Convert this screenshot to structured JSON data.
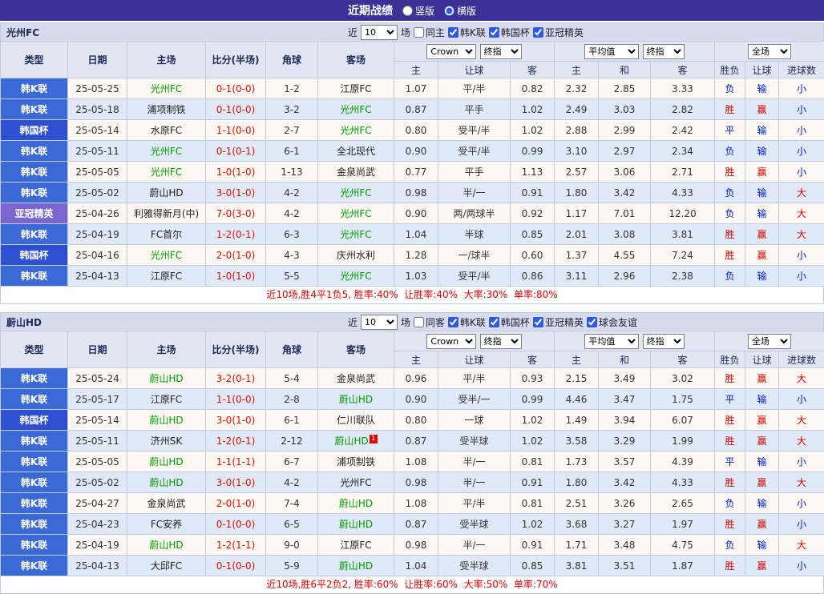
{
  "topbar": {
    "title": "近期战绩",
    "vertical_label": "竖版",
    "horizontal_label": "横版",
    "selected_layout": "横版"
  },
  "colors": {
    "topbar_bg": "#3d3195",
    "badge_k_league": "#3b69d5",
    "badge_korea_cup": "#2d4fd0",
    "badge_acl": "#7a66cf",
    "focus_team": "#009900",
    "score": "#e01000",
    "win": "#d40000",
    "lose": "#0020cc",
    "summary": "#e60000"
  },
  "sections": [
    {
      "team": "光州FC",
      "filter": {
        "near_label": "近",
        "count": "10",
        "games_label": "场",
        "same_label": "同主",
        "same_checked": false,
        "leagues": [
          {
            "label": "韩K联",
            "checked": true
          },
          {
            "label": "韩国杯",
            "checked": true
          },
          {
            "label": "亚冠精英",
            "checked": true
          }
        ]
      },
      "table": {
        "headers": [
          "类型",
          "日期",
          "主场",
          "比分(半场)",
          "角球",
          "客场"
        ],
        "bookmaker": "Crown",
        "stage1": "终指",
        "average": "平均值",
        "stage2": "终指",
        "scope": "全场",
        "sub_headers": [
          "主",
          "让球",
          "客",
          "主",
          "和",
          "客",
          "胜负",
          "让球",
          "进球数"
        ],
        "rows": [
          {
            "type": "韩K联",
            "comp": "k",
            "date": "25-05-25",
            "home": "光州FC",
            "home_focus": true,
            "score": "0-1(0-0)",
            "corner": "1-2",
            "away": "江原FC",
            "away_focus": false,
            "ah_home": "1.07",
            "ah_line": "平/半",
            "ah_away": "0.82",
            "eu_home": "2.32",
            "eu_draw": "2.85",
            "eu_away": "3.33",
            "outcome": "负",
            "outcome_state": "lose",
            "handicap_result": "输",
            "handicap_state": "lose",
            "goals": "小",
            "goals_state": "small"
          },
          {
            "type": "韩K联",
            "comp": "k",
            "date": "25-05-18",
            "home": "浦项制铁",
            "home_focus": false,
            "score": "0-1(0-0)",
            "corner": "3-2",
            "away": "光州FC",
            "away_focus": true,
            "ah_home": "0.87",
            "ah_line": "平手",
            "ah_away": "1.02",
            "eu_home": "2.49",
            "eu_draw": "3.03",
            "eu_away": "2.82",
            "outcome": "胜",
            "outcome_state": "win",
            "handicap_result": "赢",
            "handicap_state": "win",
            "goals": "小",
            "goals_state": "small"
          },
          {
            "type": "韩国杯",
            "comp": "cup",
            "date": "25-05-14",
            "home": "水原FC",
            "home_focus": false,
            "score": "1-1(0-0)",
            "corner": "2-7",
            "away": "光州FC",
            "away_focus": true,
            "ah_home": "0.80",
            "ah_line": "受平/半",
            "ah_away": "1.02",
            "eu_home": "2.88",
            "eu_draw": "2.99",
            "eu_away": "2.42",
            "outcome": "平",
            "outcome_state": "draw",
            "handicap_result": "输",
            "handicap_state": "lose",
            "goals": "小",
            "goals_state": "small"
          },
          {
            "type": "韩K联",
            "comp": "k",
            "date": "25-05-11",
            "home": "光州FC",
            "home_focus": true,
            "score": "0-1(0-1)",
            "corner": "6-1",
            "away": "全北现代",
            "away_focus": false,
            "ah_home": "0.90",
            "ah_line": "受平/半",
            "ah_away": "0.99",
            "eu_home": "3.10",
            "eu_draw": "2.97",
            "eu_away": "2.34",
            "outcome": "负",
            "outcome_state": "lose",
            "handicap_result": "输",
            "handicap_state": "lose",
            "goals": "小",
            "goals_state": "small"
          },
          {
            "type": "韩K联",
            "comp": "k",
            "date": "25-05-05",
            "home": "光州FC",
            "home_focus": true,
            "score": "1-0(1-0)",
            "corner": "1-13",
            "away": "金泉尚武",
            "away_focus": false,
            "ah_home": "0.77",
            "ah_line": "平手",
            "ah_away": "1.13",
            "eu_home": "2.57",
            "eu_draw": "3.06",
            "eu_away": "2.71",
            "outcome": "胜",
            "outcome_state": "win",
            "handicap_result": "赢",
            "handicap_state": "win",
            "goals": "小",
            "goals_state": "small"
          },
          {
            "type": "韩K联",
            "comp": "k",
            "date": "25-05-02",
            "home": "蔚山HD",
            "home_focus": false,
            "score": "3-0(1-0)",
            "corner": "4-2",
            "away": "光州FC",
            "away_focus": true,
            "ah_home": "0.98",
            "ah_line": "半/一",
            "ah_away": "0.91",
            "eu_home": "1.80",
            "eu_draw": "3.42",
            "eu_away": "4.33",
            "outcome": "负",
            "outcome_state": "lose",
            "handicap_result": "输",
            "handicap_state": "lose",
            "goals": "大",
            "goals_state": "big"
          },
          {
            "type": "亚冠精英",
            "comp": "acl",
            "date": "25-04-26",
            "home": "利雅得新月(中)",
            "home_focus": false,
            "score": "7-0(3-0)",
            "corner": "4-2",
            "away": "光州FC",
            "away_focus": true,
            "ah_home": "0.90",
            "ah_line": "两/两球半",
            "ah_away": "0.92",
            "eu_home": "1.17",
            "eu_draw": "7.01",
            "eu_away": "12.20",
            "outcome": "负",
            "outcome_state": "lose",
            "handicap_result": "输",
            "handicap_state": "lose",
            "goals": "大",
            "goals_state": "big"
          },
          {
            "type": "韩K联",
            "comp": "k",
            "date": "25-04-19",
            "home": "FC首尔",
            "home_focus": false,
            "score": "1-2(0-1)",
            "corner": "6-3",
            "away": "光州FC",
            "away_focus": true,
            "ah_home": "1.04",
            "ah_line": "半球",
            "ah_away": "0.85",
            "eu_home": "2.01",
            "eu_draw": "3.08",
            "eu_away": "3.81",
            "outcome": "胜",
            "outcome_state": "win",
            "handicap_result": "赢",
            "handicap_state": "win",
            "goals": "大",
            "goals_state": "big"
          },
          {
            "type": "韩国杯",
            "comp": "cup",
            "date": "25-04-16",
            "home": "光州FC",
            "home_focus": true,
            "score": "2-0(1-0)",
            "corner": "4-3",
            "away": "庆州水利",
            "away_focus": false,
            "ah_home": "1.28",
            "ah_line": "一/球半",
            "ah_away": "0.60",
            "eu_home": "1.37",
            "eu_draw": "4.55",
            "eu_away": "7.24",
            "outcome": "胜",
            "outcome_state": "win",
            "handicap_result": "赢",
            "handicap_state": "win",
            "goals": "小",
            "goals_state": "small"
          },
          {
            "type": "韩K联",
            "comp": "k",
            "date": "25-04-13",
            "home": "江原FC",
            "home_focus": false,
            "score": "1-0(1-0)",
            "corner": "5-5",
            "away": "光州FC",
            "away_focus": true,
            "ah_home": "1.03",
            "ah_line": "受平/半",
            "ah_away": "0.86",
            "eu_home": "3.11",
            "eu_draw": "2.96",
            "eu_away": "2.38",
            "outcome": "负",
            "outcome_state": "lose",
            "handicap_result": "输",
            "handicap_state": "lose",
            "goals": "小",
            "goals_state": "small"
          }
        ]
      },
      "summary": "近10场,胜4平1负5, 胜率:40%  让胜率:40%  大率:30%  单率:80%"
    },
    {
      "team": "蔚山HD",
      "filter": {
        "near_label": "近",
        "count": "10",
        "games_label": "场",
        "same_label": "同客",
        "same_checked": false,
        "leagues": [
          {
            "label": "韩K联",
            "checked": true
          },
          {
            "label": "韩国杯",
            "checked": true
          },
          {
            "label": "亚冠精英",
            "checked": true
          },
          {
            "label": "球会友谊",
            "checked": true
          }
        ]
      },
      "table": {
        "headers": [
          "类型",
          "日期",
          "主场",
          "比分(半场)",
          "角球",
          "客场"
        ],
        "bookmaker": "Crown",
        "stage1": "终指",
        "average": "平均值",
        "stage2": "终指",
        "scope": "全场",
        "sub_headers": [
          "主",
          "让球",
          "客",
          "主",
          "和",
          "客",
          "胜负",
          "让球",
          "进球数"
        ],
        "rows": [
          {
            "type": "韩K联",
            "comp": "k",
            "date": "25-05-24",
            "home": "蔚山HD",
            "home_focus": true,
            "score": "3-2(0-1)",
            "corner": "5-4",
            "away": "金泉尚武",
            "away_focus": false,
            "ah_home": "0.96",
            "ah_line": "平/半",
            "ah_away": "0.93",
            "eu_home": "2.15",
            "eu_draw": "3.49",
            "eu_away": "3.02",
            "outcome": "胜",
            "outcome_state": "win",
            "handicap_result": "赢",
            "handicap_state": "win",
            "goals": "大",
            "goals_state": "big"
          },
          {
            "type": "韩K联",
            "comp": "k",
            "date": "25-05-17",
            "home": "江原FC",
            "home_focus": false,
            "score": "1-1(0-0)",
            "corner": "2-8",
            "away": "蔚山HD",
            "away_focus": true,
            "ah_home": "0.90",
            "ah_line": "受半/一",
            "ah_away": "0.99",
            "eu_home": "4.46",
            "eu_draw": "3.47",
            "eu_away": "1.75",
            "outcome": "平",
            "outcome_state": "draw",
            "handicap_result": "输",
            "handicap_state": "lose",
            "goals": "小",
            "goals_state": "small"
          },
          {
            "type": "韩国杯",
            "comp": "cup",
            "date": "25-05-14",
            "home": "蔚山HD",
            "home_focus": true,
            "score": "3-0(1-0)",
            "corner": "6-1",
            "away": "仁川联队",
            "away_focus": false,
            "ah_home": "0.80",
            "ah_line": "一球",
            "ah_away": "1.02",
            "eu_home": "1.49",
            "eu_draw": "3.94",
            "eu_away": "6.07",
            "outcome": "胜",
            "outcome_state": "win",
            "handicap_result": "赢",
            "handicap_state": "win",
            "goals": "大",
            "goals_state": "big"
          },
          {
            "type": "韩K联",
            "comp": "k",
            "date": "25-05-11",
            "home": "济州SK",
            "home_focus": false,
            "score": "1-2(0-1)",
            "corner": "2-12",
            "away": "蔚山HD",
            "away_focus": true,
            "away_card": "1",
            "ah_home": "0.87",
            "ah_line": "受半球",
            "ah_away": "1.02",
            "eu_home": "3.58",
            "eu_draw": "3.29",
            "eu_away": "1.99",
            "outcome": "胜",
            "outcome_state": "win",
            "handicap_result": "赢",
            "handicap_state": "win",
            "goals": "大",
            "goals_state": "big"
          },
          {
            "type": "韩K联",
            "comp": "k",
            "date": "25-05-05",
            "home": "蔚山HD",
            "home_focus": true,
            "score": "1-1(1-1)",
            "corner": "6-7",
            "away": "浦项制铁",
            "away_focus": false,
            "ah_home": "1.08",
            "ah_line": "半/一",
            "ah_away": "0.81",
            "eu_home": "1.73",
            "eu_draw": "3.57",
            "eu_away": "4.39",
            "outcome": "平",
            "outcome_state": "draw",
            "handicap_result": "输",
            "handicap_state": "lose",
            "goals": "小",
            "goals_state": "small"
          },
          {
            "type": "韩K联",
            "comp": "k",
            "date": "25-05-02",
            "home": "蔚山HD",
            "home_focus": true,
            "score": "3-0(1-0)",
            "corner": "4-2",
            "away": "光州FC",
            "away_focus": false,
            "ah_home": "0.98",
            "ah_line": "半/一",
            "ah_away": "0.91",
            "eu_home": "1.80",
            "eu_draw": "3.42",
            "eu_away": "4.33",
            "outcome": "胜",
            "outcome_state": "win",
            "handicap_result": "赢",
            "handicap_state": "win",
            "goals": "大",
            "goals_state": "big"
          },
          {
            "type": "韩K联",
            "comp": "k",
            "date": "25-04-27",
            "home": "金泉尚武",
            "home_focus": false,
            "score": "2-0(1-0)",
            "corner": "7-4",
            "away": "蔚山HD",
            "away_focus": true,
            "ah_home": "1.08",
            "ah_line": "平/半",
            "ah_away": "0.81",
            "eu_home": "2.51",
            "eu_draw": "3.26",
            "eu_away": "2.65",
            "outcome": "负",
            "outcome_state": "lose",
            "handicap_result": "输",
            "handicap_state": "lose",
            "goals": "小",
            "goals_state": "small"
          },
          {
            "type": "韩K联",
            "comp": "k",
            "date": "25-04-23",
            "home": "FC安养",
            "home_focus": false,
            "score": "0-1(0-0)",
            "corner": "6-5",
            "away": "蔚山HD",
            "away_focus": true,
            "ah_home": "0.87",
            "ah_line": "受半球",
            "ah_away": "1.02",
            "eu_home": "3.68",
            "eu_draw": "3.27",
            "eu_away": "1.97",
            "outcome": "胜",
            "outcome_state": "win",
            "handicap_result": "赢",
            "handicap_state": "win",
            "goals": "小",
            "goals_state": "small"
          },
          {
            "type": "韩K联",
            "comp": "k",
            "date": "25-04-19",
            "home": "蔚山HD",
            "home_focus": true,
            "score": "1-2(1-1)",
            "corner": "9-0",
            "away": "江原FC",
            "away_focus": false,
            "ah_home": "0.98",
            "ah_line": "半/一",
            "ah_away": "0.91",
            "eu_home": "1.71",
            "eu_draw": "3.48",
            "eu_away": "4.75",
            "outcome": "负",
            "outcome_state": "lose",
            "handicap_result": "输",
            "handicap_state": "lose",
            "goals": "大",
            "goals_state": "big"
          },
          {
            "type": "韩K联",
            "comp": "k",
            "date": "25-04-13",
            "home": "大邱FC",
            "home_focus": false,
            "score": "0-1(0-0)",
            "corner": "5-9",
            "away": "蔚山HD",
            "away_focus": true,
            "ah_home": "1.04",
            "ah_line": "受半球",
            "ah_away": "0.85",
            "eu_home": "3.81",
            "eu_draw": "3.51",
            "eu_away": "1.87",
            "outcome": "胜",
            "outcome_state": "win",
            "handicap_result": "赢",
            "handicap_state": "win",
            "goals": "小",
            "goals_state": "small"
          }
        ]
      },
      "summary": "近10场,胜6平2负2, 胜率:60%  让胜率:60%  大率:50%  单率:70%"
    }
  ]
}
